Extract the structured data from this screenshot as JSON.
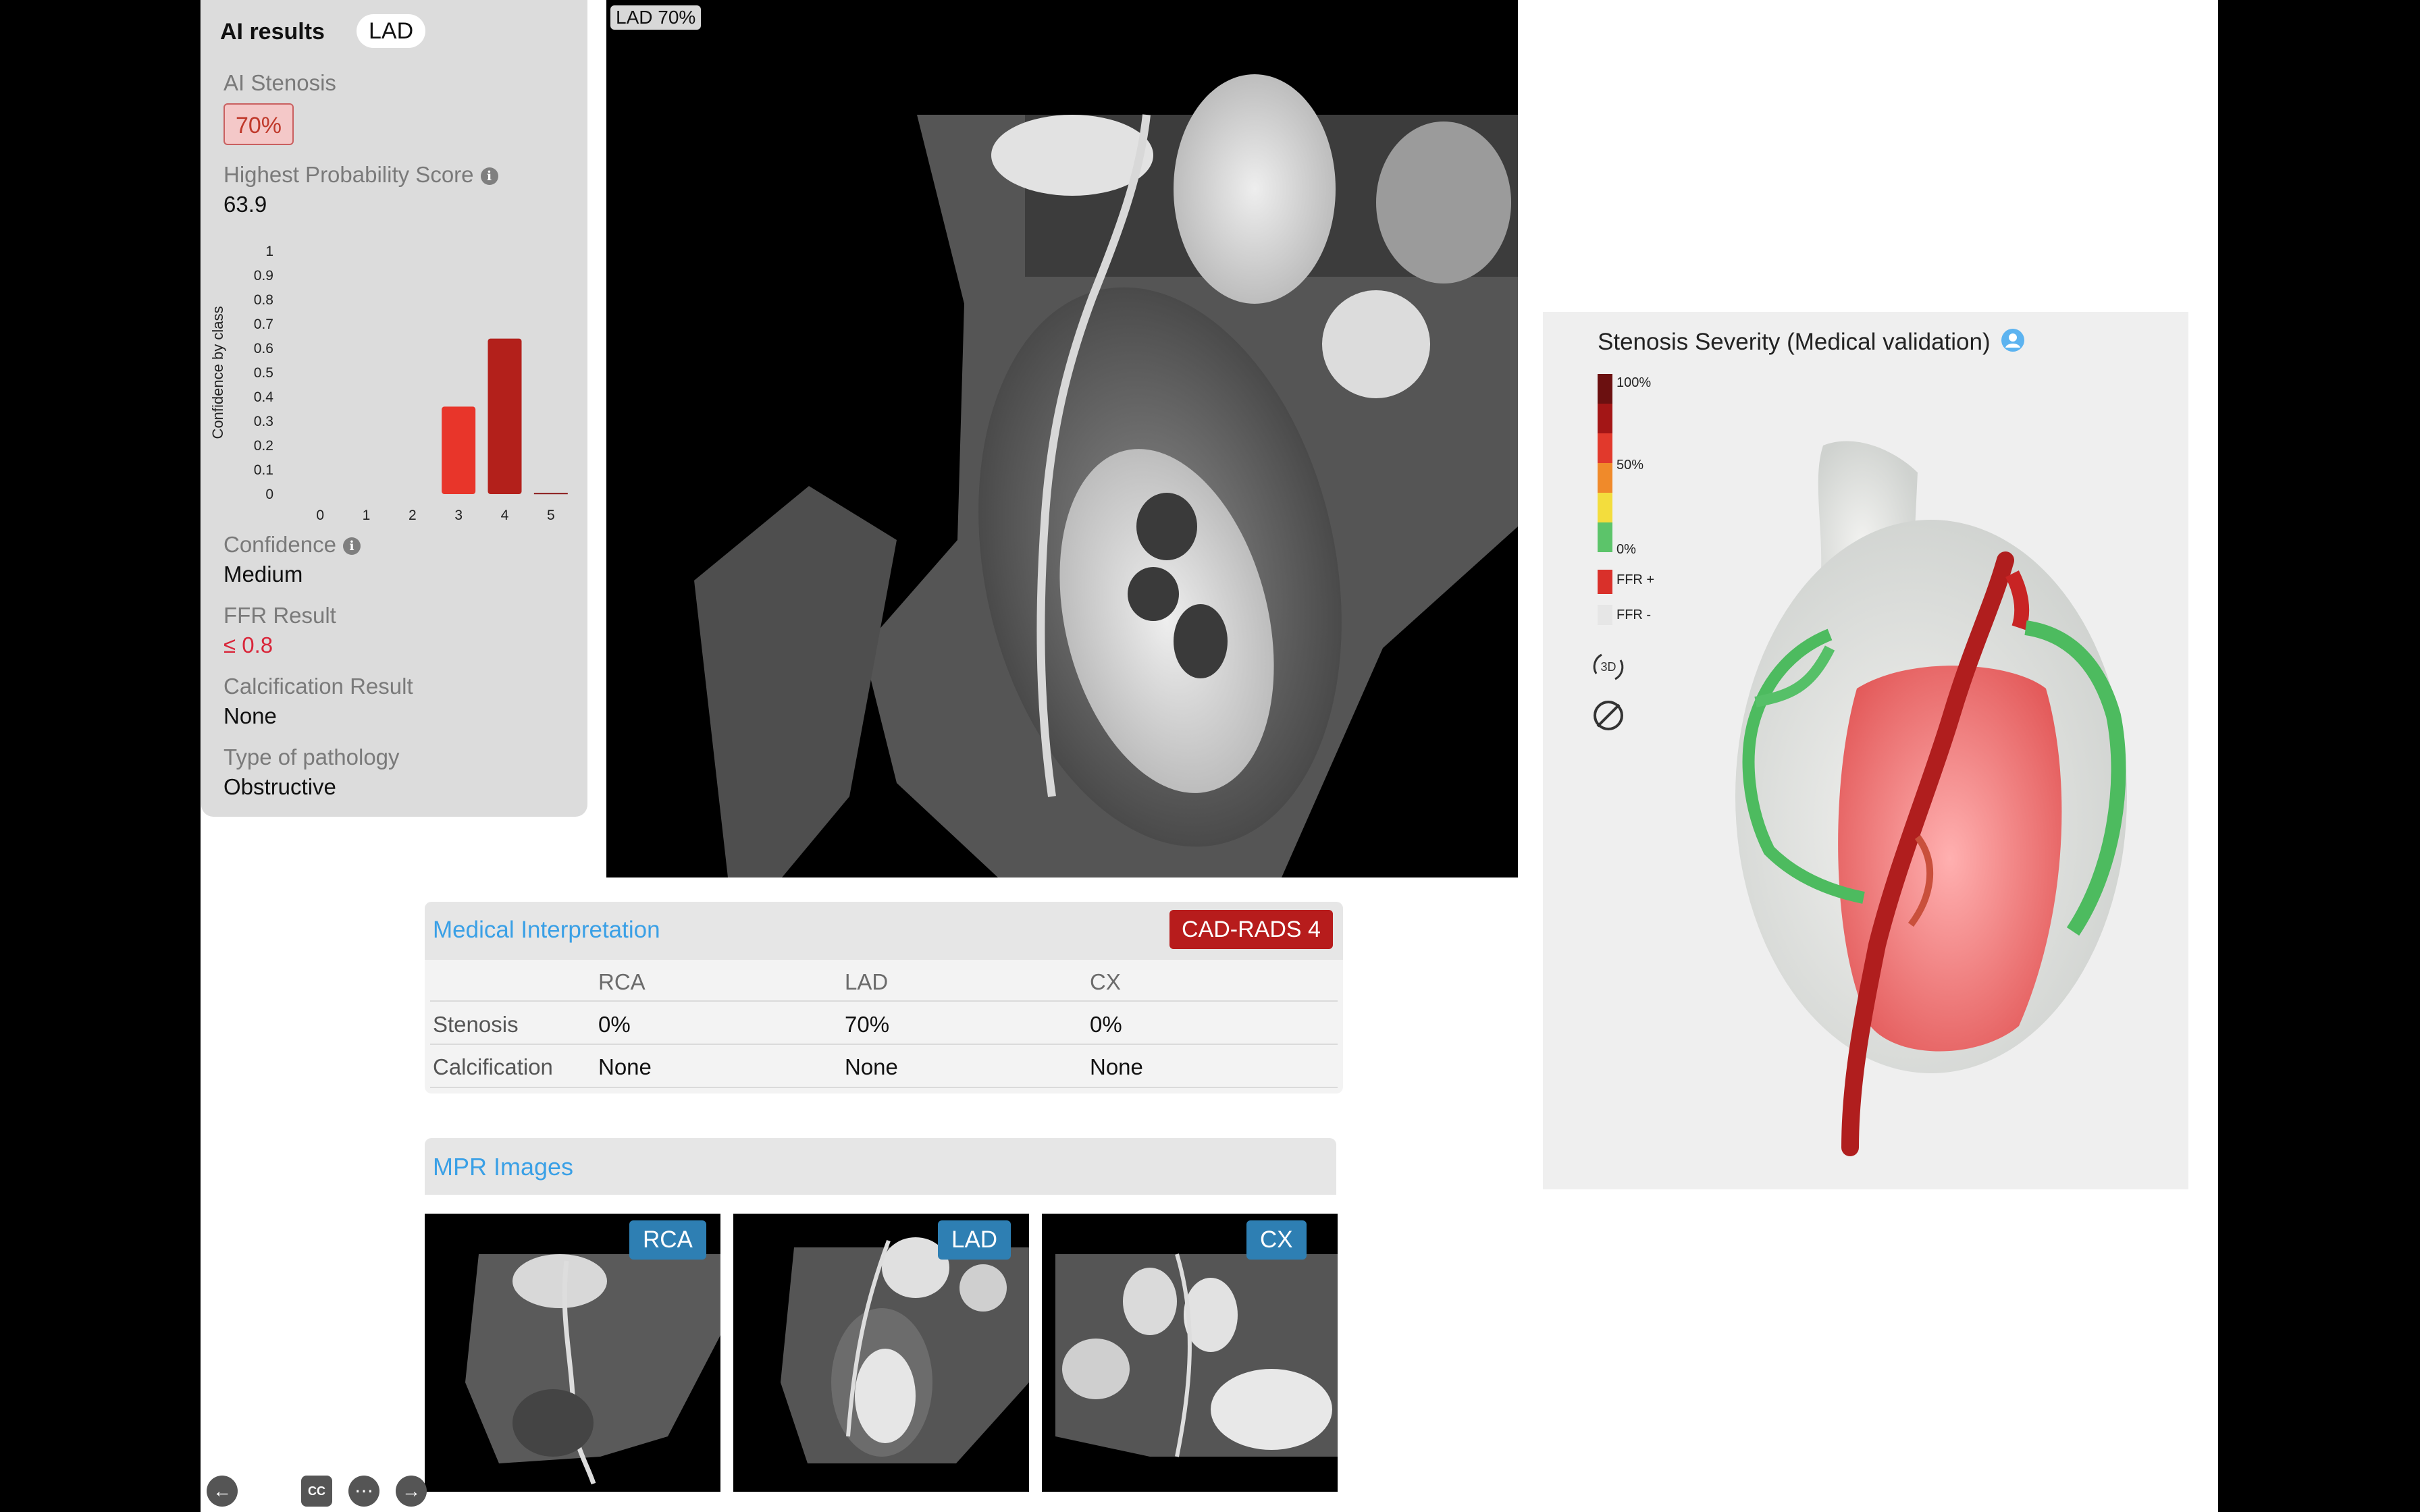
{
  "ai_results": {
    "title": "AI results",
    "vessel_pill": "LAD",
    "stenosis_label": "AI Stenosis",
    "stenosis_value": "70%",
    "prob_label": "Highest Probability Score",
    "prob_value": "63.9",
    "confidence_label": "Confidence",
    "confidence_value": "Medium",
    "ffr_label": "FFR Result",
    "ffr_value": "≤ 0.8",
    "calc_label": "Calcification Result",
    "calc_value": "None",
    "pathology_label": "Type of pathology",
    "pathology_value": "Obstructive",
    "info_icon": "info-icon"
  },
  "chart_data": {
    "type": "bar",
    "categories": [
      "0",
      "1",
      "2",
      "3",
      "4",
      "5"
    ],
    "values": [
      0,
      0,
      0,
      0.36,
      0.64,
      0.005
    ],
    "ylabel": "Confidence by class",
    "ylim": [
      0,
      1
    ],
    "yticks": [
      "0",
      "0.1",
      "0.2",
      "0.3",
      "0.4",
      "0.5",
      "0.6",
      "0.7",
      "0.8",
      "0.9",
      "1"
    ],
    "colors": [
      "#e84a4a",
      "#e84a4a",
      "#e84a4a",
      "#e8352a",
      "#b3201b",
      "#8b1a1a"
    ]
  },
  "ct_main": {
    "tag": "LAD 70%"
  },
  "interpretation": {
    "title": "Medical Interpretation",
    "badge": "CAD-RADS 4",
    "columns": [
      "RCA",
      "LAD",
      "CX"
    ],
    "rows": [
      {
        "label": "Stenosis",
        "values": [
          "0%",
          "70%",
          "0%"
        ]
      },
      {
        "label": "Calcification",
        "values": [
          "None",
          "None",
          "None"
        ]
      }
    ]
  },
  "mpr": {
    "title": "MPR Images",
    "tabs": [
      "RCA",
      "LAD",
      "CX"
    ]
  },
  "severity": {
    "title": "Stenosis Severity (Medical validation)",
    "legend": [
      "100%",
      "50%",
      "0%",
      "FFR +",
      "FFR -"
    ],
    "icons": [
      "3d-rotate-icon",
      "hide-icon",
      "person-icon"
    ],
    "rotate_label": "3D"
  },
  "toolbar": {
    "icons": [
      "back-icon",
      "pencil-icon",
      "cc-icon",
      "more-icon",
      "forward-icon"
    ],
    "cc_label": "CC"
  }
}
